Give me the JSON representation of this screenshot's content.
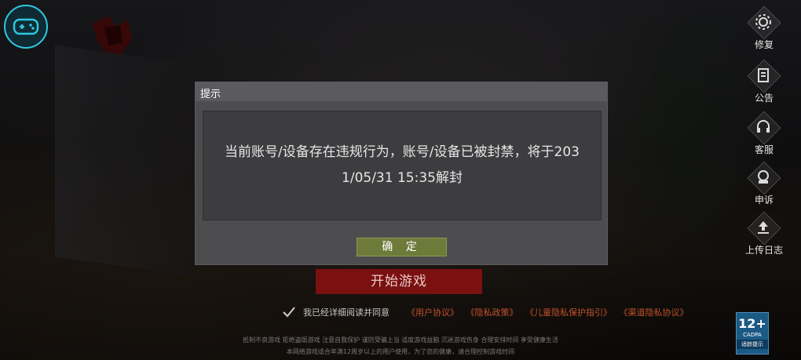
{
  "top_left": {
    "icon": "gamepad-icon"
  },
  "side_menu": [
    {
      "label": "修复",
      "icon": "gear-icon"
    },
    {
      "label": "公告",
      "icon": "notice-icon"
    },
    {
      "label": "客服",
      "icon": "headset-icon"
    },
    {
      "label": "申诉",
      "icon": "appeal-icon"
    },
    {
      "label": "上传日志",
      "icon": "upload-icon"
    }
  ],
  "dialog": {
    "title": "提示",
    "message_line1": "当前账号/设备存在违规行为，账号/设备已被封禁，将于203",
    "message_line2": "1/05/31 15:35解封",
    "confirm_label": "确 定"
  },
  "start_button": {
    "label": "开始游戏"
  },
  "agreement": {
    "text": "我已经详细阅读并同意",
    "links": [
      "《用户协议》",
      "《隐私政策》",
      "《儿童隐私保护指引》",
      "《渠道隐私协议》"
    ]
  },
  "footer": {
    "line1": "抵制不良游戏 拒绝盗版游戏 注意自我保护 谨防受骗上当 适度游戏益脑 沉迷游戏伤身 合理安排时间 享受健康生活",
    "line2": "本网络游戏适合年满12周岁以上的用户使用，为了您的健康，请合理控制游戏时间"
  },
  "age_rating": {
    "number": "12+",
    "org": "CADPA",
    "note": "适龄提示"
  }
}
